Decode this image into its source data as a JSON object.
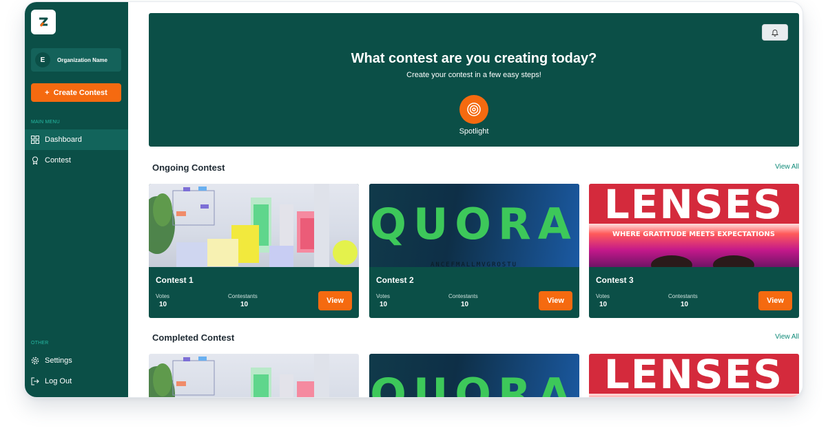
{
  "sidebar": {
    "org_initial": "E",
    "org_name": "Organization Name",
    "create_label": "Create Contest",
    "create_plus": "+",
    "main_menu_label": "MAIN MENU",
    "main_items": [
      {
        "label": "Dashboard",
        "icon": "grid-icon",
        "active": true
      },
      {
        "label": "Contest",
        "icon": "award-icon",
        "active": false
      }
    ],
    "other_label": "OTHER",
    "other_items": [
      {
        "label": "Settings",
        "icon": "gear-icon"
      },
      {
        "label": "Log Out",
        "icon": "logout-icon"
      }
    ]
  },
  "hero": {
    "title": "What contest are you creating today?",
    "subtitle": "Create your contest in a few easy steps!",
    "spotlight_label": "Spotlight"
  },
  "ongoing": {
    "title": "Ongoing Contest",
    "view_all": "View All",
    "cards": [
      {
        "title": "Contest 1",
        "votes_label": "Votes",
        "votes": "10",
        "contestants_label": "Contestants",
        "contestants": "10",
        "button": "View"
      },
      {
        "title": "Contest 2",
        "votes_label": "Votes",
        "votes": "10",
        "contestants_label": "Contestants",
        "contestants": "10",
        "button": "View"
      },
      {
        "title": "Contest 3",
        "votes_label": "Votes",
        "votes": "10",
        "contestants_label": "Contestants",
        "contestants": "10",
        "button": "View"
      }
    ]
  },
  "completed": {
    "title": "Completed Contest",
    "view_all": "View All"
  },
  "images": {
    "quora_text": "QUORA",
    "quora_sub": "ANCEFMALLMVGROSTU",
    "lenses_text": "LENSES",
    "lenses_sub": "WHERE GRATITUDE MEETS EXPECTATIONS"
  },
  "colors": {
    "brand_green": "#0b4f47",
    "accent_orange": "#f56a10",
    "menu_teal": "#26b9a3",
    "link_teal": "#0f8a78"
  }
}
